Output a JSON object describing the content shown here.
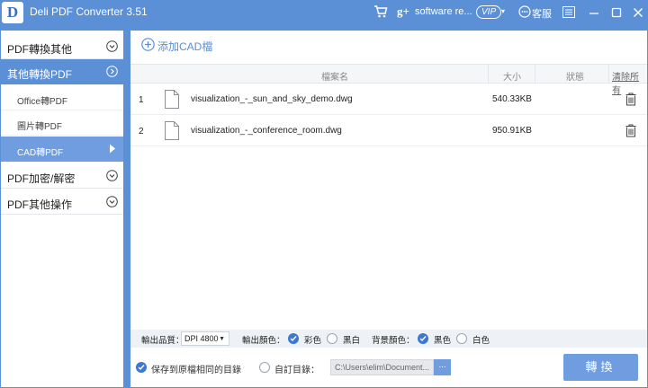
{
  "titlebar": {
    "logo_letter": "D",
    "app_title": "Deli PDF Converter 3.51",
    "gplus_label": "g+",
    "user_name": "software re...",
    "vip_label": "VIP",
    "vip_caret": "▾",
    "service_label": "客服"
  },
  "sidebar": {
    "sections": [
      {
        "label": "PDF轉換其他"
      },
      {
        "label": "其他轉換PDF"
      },
      {
        "label": "PDF加密/解密"
      },
      {
        "label": "PDF其他操作"
      }
    ],
    "subitems": [
      {
        "label": "Office轉PDF"
      },
      {
        "label": "圖片轉PDF"
      },
      {
        "label": "CAD轉PDF"
      }
    ]
  },
  "content": {
    "add_button_label": "添加CAD檔",
    "columns": {
      "filename": "檔案名",
      "size": "大小",
      "status": "狀態",
      "clear_all": "清除所有"
    },
    "rows": [
      {
        "index": "1",
        "filename": "visualization_-_sun_and_sky_demo.dwg",
        "size": "540.33KB"
      },
      {
        "index": "2",
        "filename": "visualization_-_conference_room.dwg",
        "size": "950.91KB"
      }
    ]
  },
  "options": {
    "quality_label": "輸出品質：",
    "quality_value": "DPI 4800",
    "quality_caret": "▼",
    "output_color_label": "輸出顏色：",
    "color_option": "彩色",
    "bw_option": "黑白",
    "bg_color_label": "背景顏色：",
    "bg_black": "黑色",
    "bg_white": "白色"
  },
  "bottom": {
    "save_same_dir_label": "保存到原檔相同的目錄",
    "custom_dir_label": "自訂目錄：",
    "path_value": "C:\\Users\\elim\\Document...",
    "browse_label": "...",
    "convert_label": "轉換"
  },
  "colors": {
    "accent": "#5b8fd6",
    "accent_light": "#6f9ddf",
    "check_blue": "#3b78cf"
  },
  "icons": {
    "cart": "cart-icon",
    "service": "chat-bubble-icon",
    "menu": "menu-icon",
    "minimize": "minimize-icon",
    "maximize": "maximize-icon",
    "close": "close-icon",
    "file": "file-icon",
    "delete": "trash-icon",
    "add": "plus-circle-icon"
  }
}
